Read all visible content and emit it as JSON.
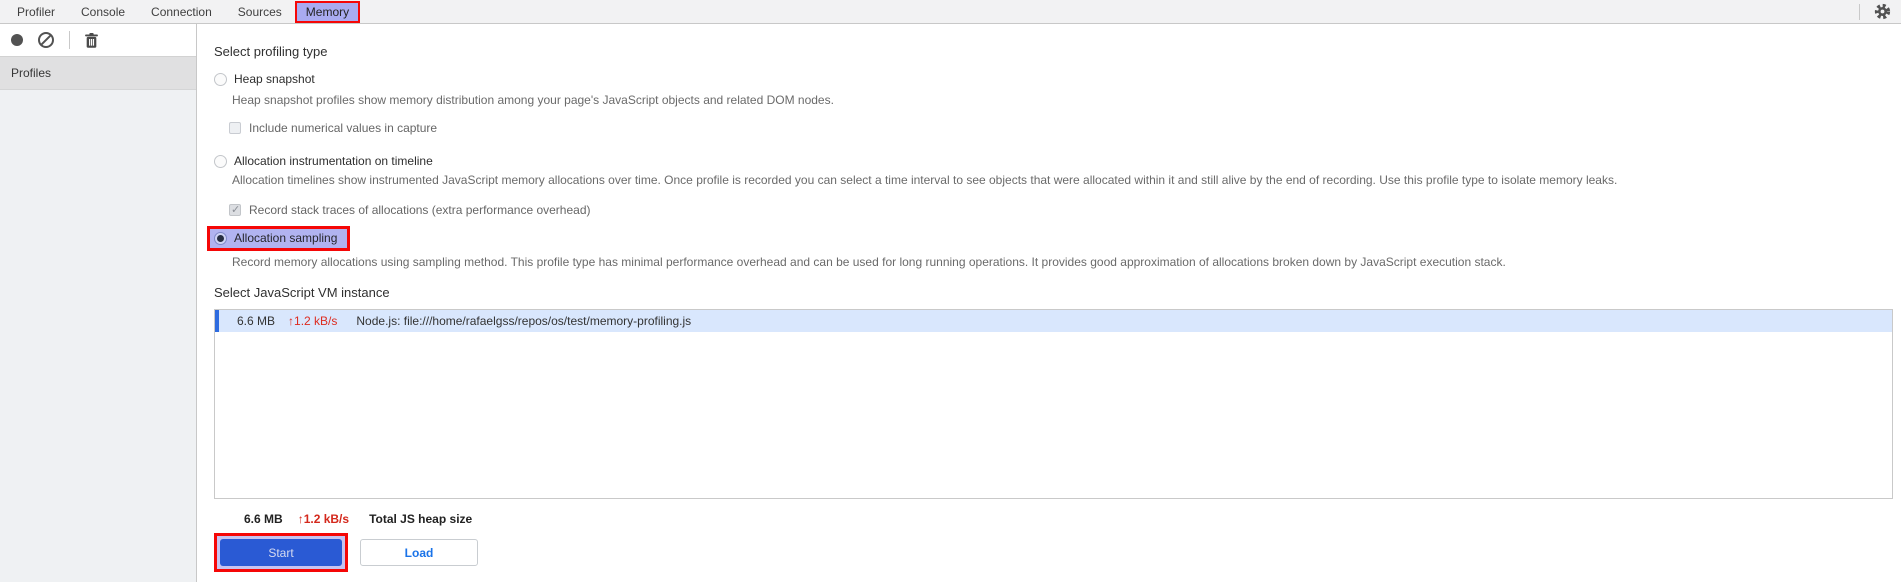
{
  "tabbar": {
    "tabs": [
      {
        "label": "Profiler"
      },
      {
        "label": "Console"
      },
      {
        "label": "Connection"
      },
      {
        "label": "Sources"
      },
      {
        "label": "Memory",
        "active": true,
        "highlighted": true
      }
    ],
    "icons": [
      "gear-icon"
    ]
  },
  "sidebar": {
    "toolbar_icons": [
      "record-icon",
      "clear-icon",
      "trash-icon"
    ],
    "header": "Profiles"
  },
  "main": {
    "profiling_type": {
      "title": "Select profiling type",
      "options": [
        {
          "label": "Heap snapshot",
          "selected": false,
          "description": "Heap snapshot profiles show memory distribution among your page's JavaScript objects and related DOM nodes.",
          "checkbox_label": "Include numerical values in capture",
          "checkbox_checked": false
        },
        {
          "label": "Allocation instrumentation on timeline",
          "selected": false,
          "description": "Allocation timelines show instrumented JavaScript memory allocations over time. Once profile is recorded you can select a time interval to see objects that were allocated within it and still alive by the end of recording. Use this profile type to isolate memory leaks.",
          "checkbox_label": "Record stack traces of allocations (extra performance overhead)",
          "checkbox_checked": true
        },
        {
          "label": "Allocation sampling",
          "selected": true,
          "highlighted": true,
          "description": "Record memory allocations using sampling method. This profile type has minimal performance overhead and can be used for long running operations. It provides good approximation of allocations broken down by JavaScript execution stack."
        }
      ]
    },
    "vm_section": {
      "title": "Select JavaScript VM instance",
      "instances": [
        {
          "size": "6.6 MB",
          "rate": "↑1.2 kB/s",
          "name": "Node.js: file:///home/rafaelgss/repos/os/test/memory-profiling.js",
          "selected": true
        }
      ],
      "total": {
        "size": "6.6 MB",
        "rate": "↑1.2 kB/s",
        "label": "Total JS heap size"
      }
    },
    "actions": {
      "start": "Start",
      "load": "Load"
    }
  },
  "colors": {
    "highlight_red": "#f50707",
    "highlight_lavender": "#a9abf0",
    "selection_row_blue": "#d9e7fd",
    "selection_accent_blue": "#2e6ce0",
    "rate_red": "#dd2c20",
    "start_button_blue": "#2a5ad4",
    "load_text_blue": "#1a73e8"
  }
}
